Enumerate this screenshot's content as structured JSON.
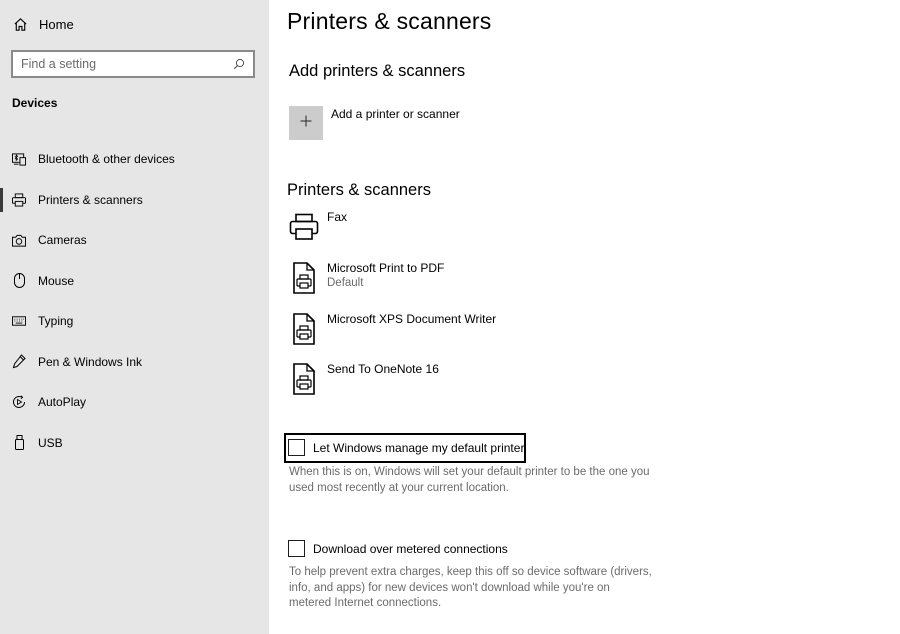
{
  "sidebar": {
    "home_label": "Home",
    "search_placeholder": "Find a setting",
    "section_title": "Devices",
    "items": [
      {
        "label": "Bluetooth & other devices",
        "icon": "bluetooth-devices-icon"
      },
      {
        "label": "Printers & scanners",
        "icon": "printer-icon",
        "active": true
      },
      {
        "label": "Cameras",
        "icon": "camera-icon"
      },
      {
        "label": "Mouse",
        "icon": "mouse-icon"
      },
      {
        "label": "Typing",
        "icon": "keyboard-icon"
      },
      {
        "label": "Pen & Windows Ink",
        "icon": "pen-icon"
      },
      {
        "label": "AutoPlay",
        "icon": "autoplay-icon"
      },
      {
        "label": "USB",
        "icon": "usb-icon"
      }
    ]
  },
  "main": {
    "title": "Printers & scanners",
    "add_section_title": "Add printers & scanners",
    "add_button_label": "Add a printer or scanner",
    "list_title": "Printers & scanners",
    "printers": [
      {
        "name": "Fax",
        "status": "",
        "icon": "fax-printer-icon"
      },
      {
        "name": "Microsoft Print to PDF",
        "status": "Default",
        "icon": "document-printer-icon"
      },
      {
        "name": "Microsoft XPS Document Writer",
        "status": "",
        "icon": "document-printer-icon"
      },
      {
        "name": "Send To OneNote 16",
        "status": "",
        "icon": "document-printer-icon"
      }
    ],
    "manage_default": {
      "label": "Let Windows manage my default printer",
      "checked": false,
      "description_line1": "When this is on, Windows will set your default printer to be the one you",
      "description_line2": "used most recently at your current location."
    },
    "metered": {
      "label": "Download over metered connections",
      "checked": false,
      "description_line1": "To help prevent extra charges, keep this off so device software (drivers,",
      "description_line2": "info, and apps) for new devices won't download while you're on",
      "description_line3": "metered Internet connections."
    }
  }
}
